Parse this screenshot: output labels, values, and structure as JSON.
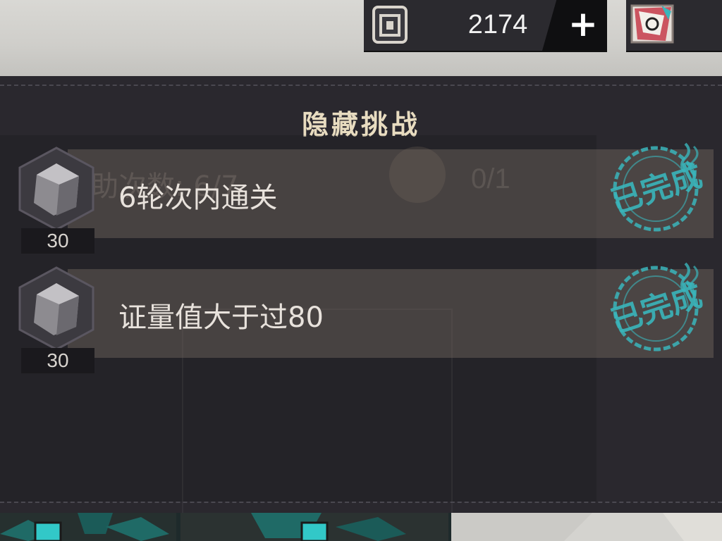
{
  "hud": {
    "currency_amount": "2174",
    "add_label": "+",
    "currency_icon": "cube-frame-icon",
    "secondary_icon": "card-pack-icon"
  },
  "panel": {
    "title": "隐藏挑战",
    "ghost_label": "合援助次数: 6/7",
    "ghost_progress": "0/1"
  },
  "tasks": [
    {
      "label": "6轮次内通关",
      "reward_count": "30",
      "status": "已完成",
      "reward_icon": "crystal-cube-icon"
    },
    {
      "label": "证量值大于过80",
      "reward_count": "30",
      "status": "已完成",
      "reward_icon": "crystal-cube-icon"
    }
  ],
  "colors": {
    "panel_bg": "#2a282e",
    "stamp": "#3ab5bb",
    "title": "#e8dcc0"
  }
}
